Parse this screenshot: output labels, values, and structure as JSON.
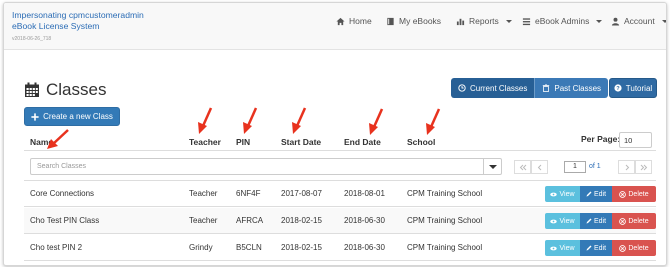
{
  "header": {
    "brand_line1": "Impersonating cpmcustomeradmin",
    "brand_line2": "eBook License System",
    "version": "v2018-06-26_718",
    "nav": [
      {
        "label": "Home"
      },
      {
        "label": "My eBooks"
      },
      {
        "label": "Reports"
      },
      {
        "label": "eBook Admins"
      },
      {
        "label": "Account"
      }
    ]
  },
  "page": {
    "title": "Classes",
    "create_button": "Create a new Class",
    "current_classes_button": "Current Classes",
    "past_classes_button": "Past Classes",
    "tutorial_button": "Tutorial"
  },
  "table": {
    "columns": [
      "Name",
      "Teacher",
      "PIN",
      "Start Date",
      "End Date",
      "School"
    ],
    "per_page_label": "Per Page:",
    "per_page_value": "10",
    "search_placeholder": "Search Classes",
    "current_page": "1",
    "page_of": "of 1",
    "rows": [
      {
        "name": "Core Connections",
        "teacher": "Teacher",
        "pin": "6NF4F",
        "start": "2017-08-07",
        "end": "2018-08-01",
        "school": "CPM Training School"
      },
      {
        "name": "Cho Test PIN Class",
        "teacher": "Teacher",
        "pin": "AFRCA",
        "start": "2018-02-15",
        "end": "2018-06-30",
        "school": "CPM Training School"
      },
      {
        "name": "Cho test PIN 2",
        "teacher": "Grindy",
        "pin": "B5CLN",
        "start": "2018-02-15",
        "end": "2018-06-30",
        "school": "CPM Training School"
      }
    ],
    "actions": {
      "view": "View",
      "edit": "Edit",
      "delete": "Delete"
    }
  },
  "colors": {
    "accent": "#337ab7",
    "brand_text": "#2b6cb5",
    "view": "#5bc0de",
    "delete": "#d9534f",
    "annotation_arrow": "#e8321e"
  }
}
